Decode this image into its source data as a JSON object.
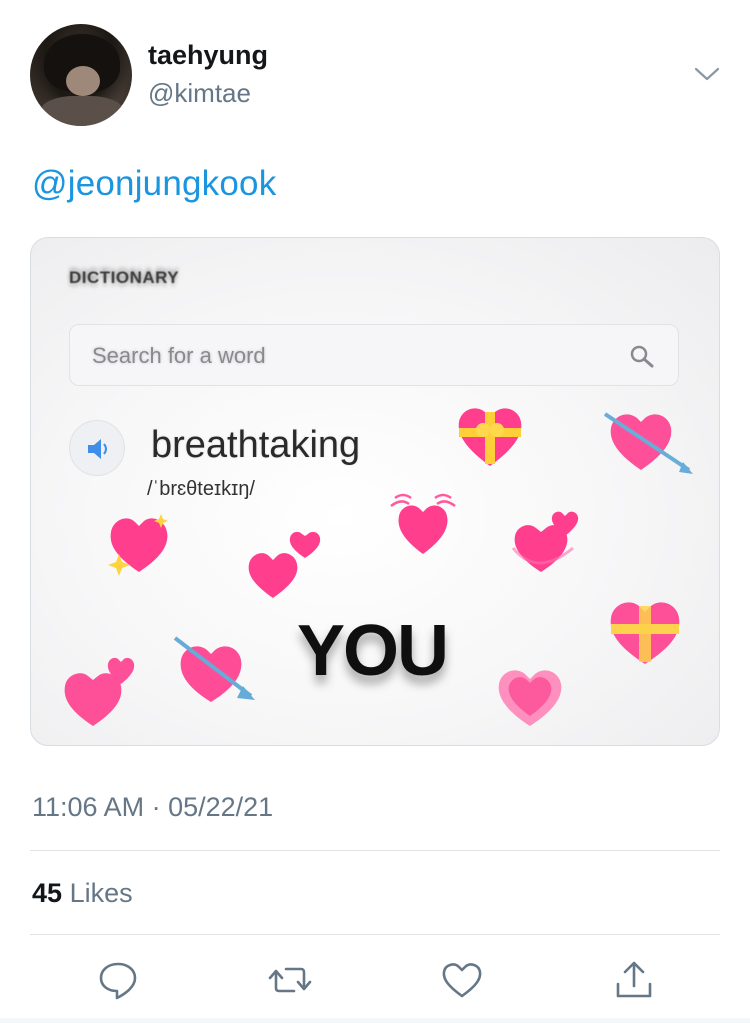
{
  "tweet": {
    "author_name": "taehyung",
    "author_handle": "@kimtae",
    "text_mention": "@jeonjungkook",
    "timestamp": "11:06 AM · 05/22/21",
    "likes_count": "45",
    "likes_label": "Likes"
  },
  "media": {
    "dictionary_title": "DICTIONARY",
    "search_placeholder": "Search for a word",
    "word": "breathtaking",
    "pronunciation": "/ˈbrɛθteɪkɪŋ/",
    "overlay_text": "YOU"
  },
  "actions": {
    "icons": [
      "reply-icon",
      "retweet-icon",
      "like-icon",
      "share-icon"
    ]
  },
  "colors": {
    "accent": "#1b95e0",
    "secondary_text": "#657786",
    "heart_pink": "#ff3f8e"
  }
}
